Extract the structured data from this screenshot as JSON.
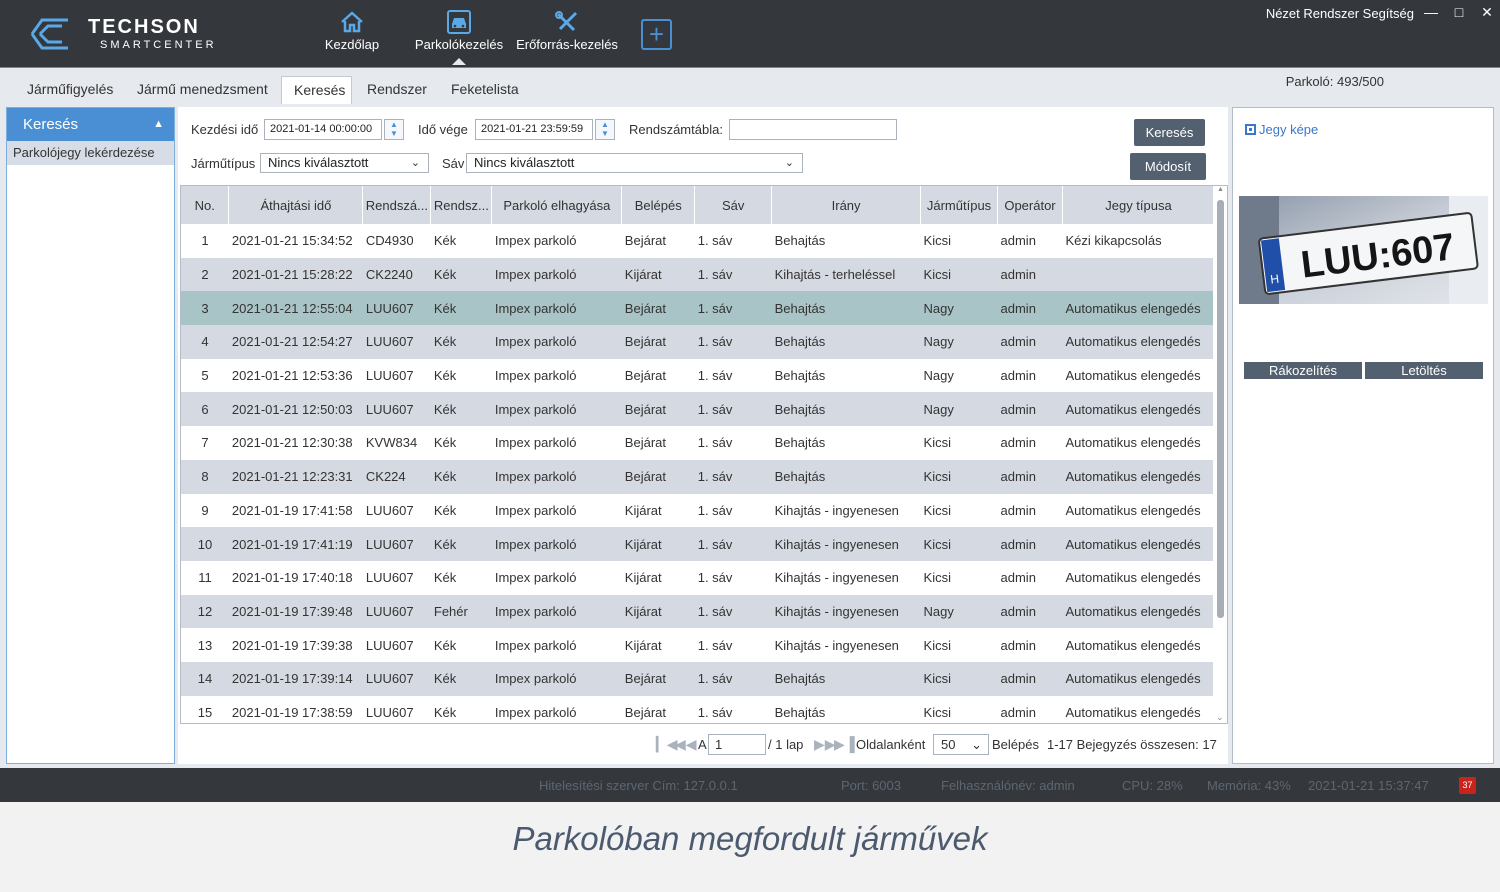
{
  "app": {
    "logo_text": "TECHSON SMARTCENTER",
    "menu": [
      "Nézet",
      "Rendszer",
      "Segítség"
    ],
    "nav": [
      {
        "label": "Kezdőlap",
        "icon": "home-icon"
      },
      {
        "label": "Parkolókezelés",
        "icon": "car-icon"
      },
      {
        "label": "Erőforrás-kezelés",
        "icon": "tools-icon"
      }
    ],
    "add_icon": "plus-icon",
    "window_controls": [
      "minimize-icon",
      "maximize-icon",
      "close-icon"
    ]
  },
  "tabs": [
    "Járműfigyelés",
    "Jármű menedzsment",
    "Keresés",
    "Rendszer",
    "Feketelista"
  ],
  "active_tab": "Keresés",
  "parking_count": "Parkoló: 493/500",
  "sidebar": {
    "header": "Keresés",
    "items": [
      "Parkolójegy lekérdezése"
    ]
  },
  "filters": {
    "start_label": "Kezdési idő",
    "start_value": "2021-01-14 00:00:00",
    "end_label": "Idő vége",
    "end_value": "2021-01-21 23:59:59",
    "plate_label": "Rendszámtábla:",
    "plate_value": "",
    "vehicle_type_label": "Járműtípus",
    "vehicle_type_value": "Nincs kiválasztott",
    "lane_label": "Sáv",
    "lane_value": "Nincs kiválasztott",
    "search_button": "Keresés",
    "modify_button": "Módosít"
  },
  "table": {
    "columns": [
      "No.",
      "Áthajtási idő",
      "Rendszá...",
      "Rendsz...",
      "Parkoló elhagyása",
      "Belépés",
      "Sáv",
      "Irány",
      "Járműtípus",
      "Operátor",
      "Jegy típusa"
    ],
    "rows": [
      [
        "1",
        "2021-01-21 15:34:52",
        "CD4930",
        "Kék",
        "Impex parkoló",
        "Bejárat",
        "1. sáv",
        "Behajtás",
        "Kicsi",
        "admin",
        "Kézi kikapcsolás"
      ],
      [
        "2",
        "2021-01-21 15:28:22",
        "CK2240",
        "Kék",
        "Impex parkoló",
        "Kijárat",
        "1. sáv",
        "Kihajtás - terheléssel",
        "Kicsi",
        "admin",
        ""
      ],
      [
        "3",
        "2021-01-21 12:55:04",
        "LUU607",
        "Kék",
        "Impex parkoló",
        "Bejárat",
        "1. sáv",
        "Behajtás",
        "Nagy",
        "admin",
        "Automatikus elengedés"
      ],
      [
        "4",
        "2021-01-21 12:54:27",
        "LUU607",
        "Kék",
        "Impex parkoló",
        "Bejárat",
        "1. sáv",
        "Behajtás",
        "Nagy",
        "admin",
        "Automatikus elengedés"
      ],
      [
        "5",
        "2021-01-21 12:53:36",
        "LUU607",
        "Kék",
        "Impex parkoló",
        "Bejárat",
        "1. sáv",
        "Behajtás",
        "Nagy",
        "admin",
        "Automatikus elengedés"
      ],
      [
        "6",
        "2021-01-21 12:50:03",
        "LUU607",
        "Kék",
        "Impex parkoló",
        "Bejárat",
        "1. sáv",
        "Behajtás",
        "Nagy",
        "admin",
        "Automatikus elengedés"
      ],
      [
        "7",
        "2021-01-21 12:30:38",
        "KVW834",
        "Kék",
        "Impex parkoló",
        "Bejárat",
        "1. sáv",
        "Behajtás",
        "Kicsi",
        "admin",
        "Automatikus elengedés"
      ],
      [
        "8",
        "2021-01-21 12:23:31",
        "CK224",
        "Kék",
        "Impex parkoló",
        "Bejárat",
        "1. sáv",
        "Behajtás",
        "Kicsi",
        "admin",
        "Automatikus elengedés"
      ],
      [
        "9",
        "2021-01-19 17:41:58",
        "LUU607",
        "Kék",
        "Impex parkoló",
        "Kijárat",
        "1. sáv",
        "Kihajtás - ingyenesen",
        "Kicsi",
        "admin",
        "Automatikus elengedés"
      ],
      [
        "10",
        "2021-01-19 17:41:19",
        "LUU607",
        "Kék",
        "Impex parkoló",
        "Kijárat",
        "1. sáv",
        "Kihajtás - ingyenesen",
        "Kicsi",
        "admin",
        "Automatikus elengedés"
      ],
      [
        "11",
        "2021-01-19 17:40:18",
        "LUU607",
        "Kék",
        "Impex parkoló",
        "Kijárat",
        "1. sáv",
        "Kihajtás - ingyenesen",
        "Kicsi",
        "admin",
        "Automatikus elengedés"
      ],
      [
        "12",
        "2021-01-19 17:39:48",
        "LUU607",
        "Fehér",
        "Impex parkoló",
        "Kijárat",
        "1. sáv",
        "Kihajtás - ingyenesen",
        "Nagy",
        "admin",
        "Automatikus elengedés"
      ],
      [
        "13",
        "2021-01-19 17:39:38",
        "LUU607",
        "Kék",
        "Impex parkoló",
        "Kijárat",
        "1. sáv",
        "Kihajtás - ingyenesen",
        "Kicsi",
        "admin",
        "Automatikus elengedés"
      ],
      [
        "14",
        "2021-01-19 17:39:14",
        "LUU607",
        "Kék",
        "Impex parkoló",
        "Bejárat",
        "1. sáv",
        "Behajtás",
        "Kicsi",
        "admin",
        "Automatikus elengedés"
      ],
      [
        "15",
        "2021-01-19 17:38:59",
        "LUU607",
        "Kék",
        "Impex parkoló",
        "Bejárat",
        "1. sáv",
        "Behajtás",
        "Kicsi",
        "admin",
        "Automatikus elengedés"
      ]
    ],
    "selected_row": 3
  },
  "pager": {
    "page_prefix": "A",
    "page_value": "1",
    "page_suffix": "/ 1 lap",
    "per_page_label": "Oldalanként",
    "per_page_value": "50",
    "enter_label": "Belépés",
    "summary": "1-17 Bejegyzés összesen: 17"
  },
  "ticket_panel": {
    "label": "Jegy képe",
    "plate_text": "LUU:607",
    "plate_country": "H",
    "zoom_button": "Rákozelítés",
    "download_button": "Letöltés"
  },
  "statusbar": {
    "server": "Hitelesítési szerver Cím: 127.0.0.1",
    "port": "Port: 6003",
    "user": "Felhasználónév: admin",
    "cpu": "CPU: 28%",
    "memory": "Memória: 43%",
    "datetime": "2021-01-21 15:37:47",
    "alert_count": "37"
  },
  "caption": "Parkolóban megfordult járművek",
  "colors": {
    "topbar": "#34383d",
    "accent": "#4a8fd4",
    "row_alt": "#d5dae2",
    "row_selected": "#a9c4c6",
    "button": "#52606f"
  }
}
